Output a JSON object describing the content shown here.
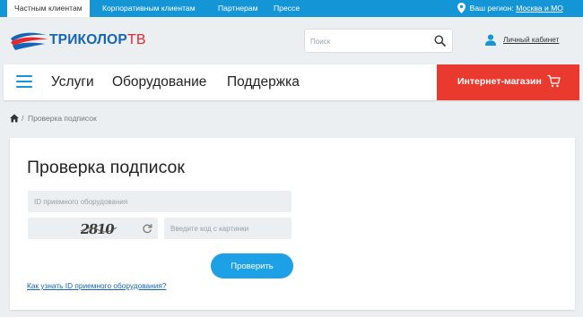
{
  "topbar": {
    "tabs": [
      "Частным клиентам",
      "Корпоративным клиентам",
      "Партнерам",
      "Прессе"
    ],
    "region_label": "Ваш регион:",
    "region_value": "Москва и МО"
  },
  "header": {
    "logo_text": "ТРИКОЛОР",
    "logo_suffix": "ТВ",
    "search_placeholder": "Поиск",
    "account_label": "Личный кабинет"
  },
  "nav": {
    "items": [
      "Услуги",
      "Оборудование",
      "Поддержка"
    ],
    "shop_label": "Интернет-магазин"
  },
  "breadcrumb": {
    "separator": "/",
    "current": "Проверка подписок"
  },
  "form": {
    "title": "Проверка подписок",
    "id_placeholder": "ID приемного оборудования",
    "captcha_text": "2810",
    "code_placeholder": "Введите код с картинки",
    "submit_label": "Проверить",
    "help_link": "Как узнать ID приемного оборудования?"
  },
  "colors": {
    "topbar": "#1495d6",
    "shop": "#ea3a2f",
    "button": "#1da0e6",
    "logo": "#1665b5",
    "logo_accent": "#e8262d"
  }
}
